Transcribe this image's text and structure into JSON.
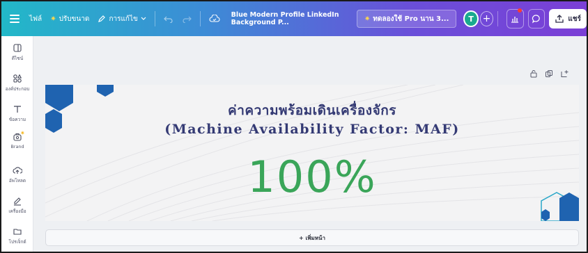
{
  "toolbar": {
    "file_label": "ไฟล์",
    "resize_label": "ปรับขนาด",
    "editing_label": "การแก้ไข",
    "document_title": "Blue Modern Profile LinkedIn Background P...",
    "pro_trial_label": "ทดลองใช้ Pro นาน 3...",
    "avatar_initial": "T",
    "share_label": "แชร์",
    "colors": {
      "gradient_start": "#22b8c8",
      "gradient_end": "#7b3fd6",
      "notification_dot": "#ff3b30"
    }
  },
  "sidebar": {
    "items": [
      {
        "label": "ดีไซน์",
        "icon": "design-icon"
      },
      {
        "label": "องค์ประกอบ",
        "icon": "elements-icon"
      },
      {
        "label": "ข้อความ",
        "icon": "text-icon"
      },
      {
        "label": "Brand",
        "icon": "brand-icon"
      },
      {
        "label": "อัพโหลด",
        "icon": "upload-icon"
      },
      {
        "label": "เครื่องมือ",
        "icon": "draw-tools-icon"
      },
      {
        "label": "โปรเจ็กต์",
        "icon": "projects-icon"
      }
    ]
  },
  "canvas": {
    "title_thai": "ค่าความพร้อมเดินเครื่องจักร",
    "title_english": "(Machine Availability Factor: MAF)",
    "value": "100%",
    "colors": {
      "title": "#343a74",
      "value": "#3aa559",
      "hexagon": "#1f63b0"
    }
  },
  "add_page": {
    "label": "+ เพิ่มหน้า"
  }
}
